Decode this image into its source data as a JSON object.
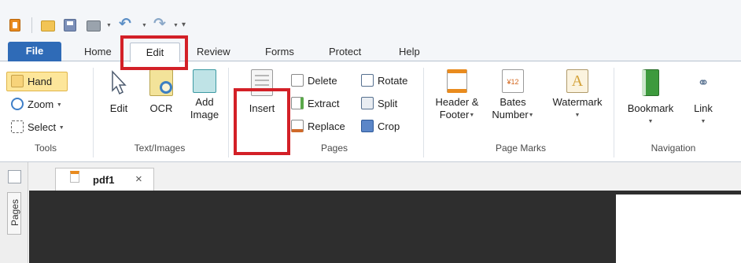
{
  "tabs": {
    "file": "File",
    "home": "Home",
    "edit": "Edit",
    "review": "Review",
    "forms": "Forms",
    "protect": "Protect",
    "help": "Help"
  },
  "ribbon": {
    "tools": {
      "label": "Tools",
      "hand": "Hand",
      "zoom": "Zoom",
      "select": "Select"
    },
    "text_images": {
      "label": "Text/Images",
      "edit": "Edit",
      "ocr": "OCR",
      "add_image_line1": "Add",
      "add_image_line2": "Image"
    },
    "pages": {
      "label": "Pages",
      "insert": "Insert",
      "delete": "Delete",
      "extract": "Extract",
      "replace": "Replace",
      "rotate": "Rotate",
      "split": "Split",
      "crop": "Crop"
    },
    "page_marks": {
      "label": "Page Marks",
      "header_footer_line1": "Header &",
      "header_footer_line2": "Footer",
      "bates_line1": "Bates",
      "bates_line2": "Number",
      "bates_icon_text": "¥12",
      "watermark": "Watermark"
    },
    "navigation": {
      "label": "Navigation",
      "bookmark": "Bookmark",
      "link": "Link"
    }
  },
  "side_panel": {
    "pages_label": "Pages"
  },
  "document": {
    "tab_name": "pdf1",
    "close_glyph": "×"
  },
  "colors": {
    "file_tab": "#2f6bb7",
    "highlight": "#d32027",
    "hand_active": "#fde69a",
    "canvas": "#2e2e2e"
  }
}
